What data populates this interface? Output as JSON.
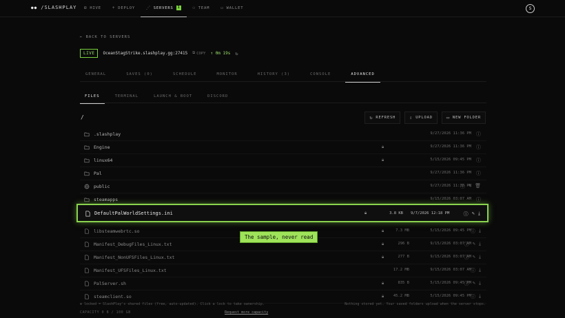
{
  "brand": {
    "logo": "●●",
    "name": "/SLASHPLAY"
  },
  "nav": [
    {
      "label": "HIVE",
      "icon": "hive-icon"
    },
    {
      "label": "DEPLOY",
      "icon": "plus-icon"
    },
    {
      "label": "SERVERS",
      "icon": "servers-icon",
      "badge": "1"
    },
    {
      "label": "TEAM",
      "icon": "team-icon"
    },
    {
      "label": "WALLET",
      "icon": "wallet-icon"
    }
  ],
  "avatar": "S",
  "back_label": "← BACK TO SERVERS",
  "server": {
    "status": "LIVE",
    "host": "OceanStagStrike.slashplay.gg:27415",
    "copy_label": "COPY",
    "uptime": "↑ 0m 19s"
  },
  "tabs": [
    "GENERAL",
    "SAVES (0)",
    "SCHEDULE",
    "MONITOR",
    "HISTORY (3)",
    "CONSOLE",
    "ADVANCED"
  ],
  "subtabs": [
    "FILES",
    "TERMINAL",
    "LAUNCH & BOOT",
    "DISCORD"
  ],
  "path": "/",
  "actions": {
    "refresh": "REFRESH",
    "upload": "UPLOAD",
    "new_folder": "NEW FOLDER"
  },
  "files": [
    {
      "name": ".slashplay",
      "type": "folder",
      "locked": false,
      "size": "",
      "date": "9/27/2026 11:36 PM"
    },
    {
      "name": "Engine",
      "type": "folder",
      "locked": true,
      "size": "",
      "date": "9/27/2026 11:36 PM"
    },
    {
      "name": "linux64",
      "type": "folder",
      "locked": true,
      "size": "",
      "date": "5/15/2026 09:45 PM"
    },
    {
      "name": "Pal",
      "type": "folder",
      "locked": false,
      "size": "",
      "date": "9/27/2026 11:36 PM"
    },
    {
      "name": "public",
      "type": "globe",
      "locked": false,
      "size": "",
      "date": "9/27/2026 11:36 PM"
    },
    {
      "name": "steamapps",
      "type": "folder",
      "locked": false,
      "size": "",
      "date": "9/15/2026 03:07 AM"
    }
  ],
  "highlighted_file": {
    "name": "DefaultPalWorldSettings.ini",
    "size": "3.8 KB",
    "date": "9/7/2026 12:18 PM"
  },
  "files_after": [
    {
      "name": "libsteamwebrtc.so",
      "size": "7.3 MB",
      "date": "5/15/2026 09:45 PM"
    },
    {
      "name": "Manifest_DebugFiles_Linux.txt",
      "size": "296 B",
      "date": "9/15/2026 03:07 AM"
    },
    {
      "name": "Manifest_NonUFSFiles_Linux.txt",
      "size": "277 B",
      "date": "9/15/2026 03:07 AM"
    },
    {
      "name": "Manifest_UFSFiles_Linux.txt",
      "size": "17.2 MB",
      "date": "9/15/2026 03:07 AM"
    },
    {
      "name": "PalServer.sh",
      "size": "835 B",
      "date": "5/15/2026 09:45 PM"
    },
    {
      "name": "steamclient.so",
      "size": "45.2 MB",
      "date": "5/15/2026 09:45 PM"
    }
  ],
  "tooltip": "The sample, never read",
  "footnote": "⊕ locked = SlashPlay's shared files (free, auto-updated). Click a lock to take ownership.",
  "footnote_right": "Nothing stored yet. Your saved folders upload when the server stops.",
  "capacity": "CAPACITY 0 B / 100 GB",
  "request_capacity": "Request more capacity",
  "colors": {
    "accent": "#7ad33c",
    "background": "#0a0a0a"
  }
}
